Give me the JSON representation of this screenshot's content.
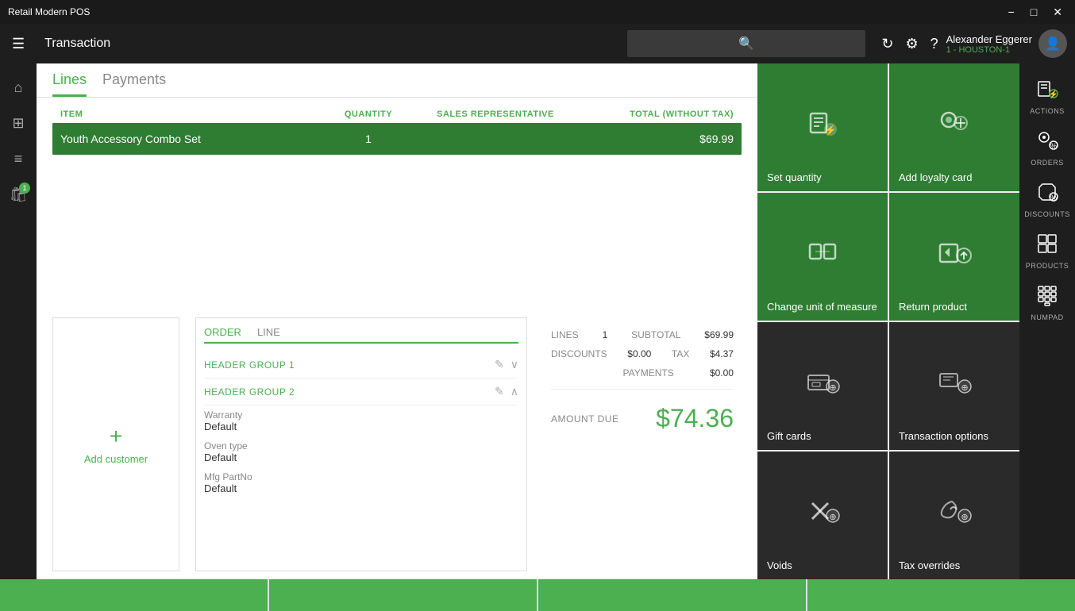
{
  "app": {
    "title": "Retail Modern POS"
  },
  "titlebar": {
    "minimize": "−",
    "maximize": "□",
    "close": "✕"
  },
  "topnav": {
    "title": "Transaction",
    "user": {
      "name": "Alexander Eggerer",
      "location": "1 - HOUSTON-1"
    }
  },
  "tabs": {
    "lines": "Lines",
    "payments": "Payments"
  },
  "table": {
    "headers": {
      "item": "ITEM",
      "quantity": "QUANTITY",
      "salesRep": "SALES REPRESENTATIVE",
      "total": "TOTAL (WITHOUT TAX)"
    },
    "rows": [
      {
        "item": "Youth Accessory Combo Set",
        "quantity": "1",
        "salesRep": "",
        "total": "$69.99"
      }
    ]
  },
  "customer": {
    "addLabel": "Add customer",
    "icon": "+"
  },
  "orderPanel": {
    "tabs": [
      "ORDER",
      "LINE"
    ],
    "headerGroups": [
      {
        "name": "HEADER GROUP 1"
      },
      {
        "name": "HEADER GROUP 2"
      }
    ],
    "fields": [
      {
        "label": "Warranty",
        "value": "Default"
      },
      {
        "label": "Oven type",
        "value": "Default"
      },
      {
        "label": "Mfg PartNo",
        "value": "Default"
      }
    ]
  },
  "summary": {
    "lines": {
      "label": "LINES",
      "value": "1"
    },
    "subtotal": {
      "label": "SUBTOTAL",
      "value": "$69.99"
    },
    "discounts": {
      "label": "DISCOUNTS",
      "value": "$0.00"
    },
    "tax": {
      "label": "TAX",
      "value": "$4.37"
    },
    "payments": {
      "label": "PAYMENTS",
      "value": "$0.00"
    },
    "amountDue": {
      "label": "AMOUNT DUE",
      "value": "$74.36"
    }
  },
  "actionTiles": {
    "row1": [
      {
        "id": "set-quantity",
        "label": "Set quantity",
        "color": "green"
      },
      {
        "id": "add-loyalty-card",
        "label": "Add loyalty card",
        "color": "green"
      }
    ],
    "row2": [
      {
        "id": "change-unit",
        "label": "Change unit of measure",
        "color": "green"
      },
      {
        "id": "return-product",
        "label": "Return product",
        "color": "green"
      }
    ],
    "row3": [
      {
        "id": "gift-cards",
        "label": "Gift cards",
        "color": "dark"
      },
      {
        "id": "transaction-options",
        "label": "Transaction options",
        "color": "dark"
      }
    ],
    "row4": [
      {
        "id": "voids",
        "label": "Voids",
        "color": "dark"
      },
      {
        "id": "tax-overrides",
        "label": "Tax overrides",
        "color": "dark"
      }
    ]
  },
  "rightNav": [
    {
      "id": "actions",
      "label": "ACTIONS"
    },
    {
      "id": "orders",
      "label": "ORDERS"
    },
    {
      "id": "discounts",
      "label": "DISCOUNTS"
    },
    {
      "id": "products",
      "label": "PRODUCTS"
    },
    {
      "id": "numpad",
      "label": "NUMPAD"
    }
  ],
  "leftNav": [
    {
      "id": "home",
      "icon": "⌂"
    },
    {
      "id": "grid",
      "icon": "⊞"
    },
    {
      "id": "menu",
      "icon": "≡"
    },
    {
      "id": "bag",
      "icon": "🛍",
      "badge": "1"
    }
  ],
  "colors": {
    "green": "#2e7d32",
    "darkTile": "#2a2a2a",
    "activeTab": "#4caf50"
  }
}
